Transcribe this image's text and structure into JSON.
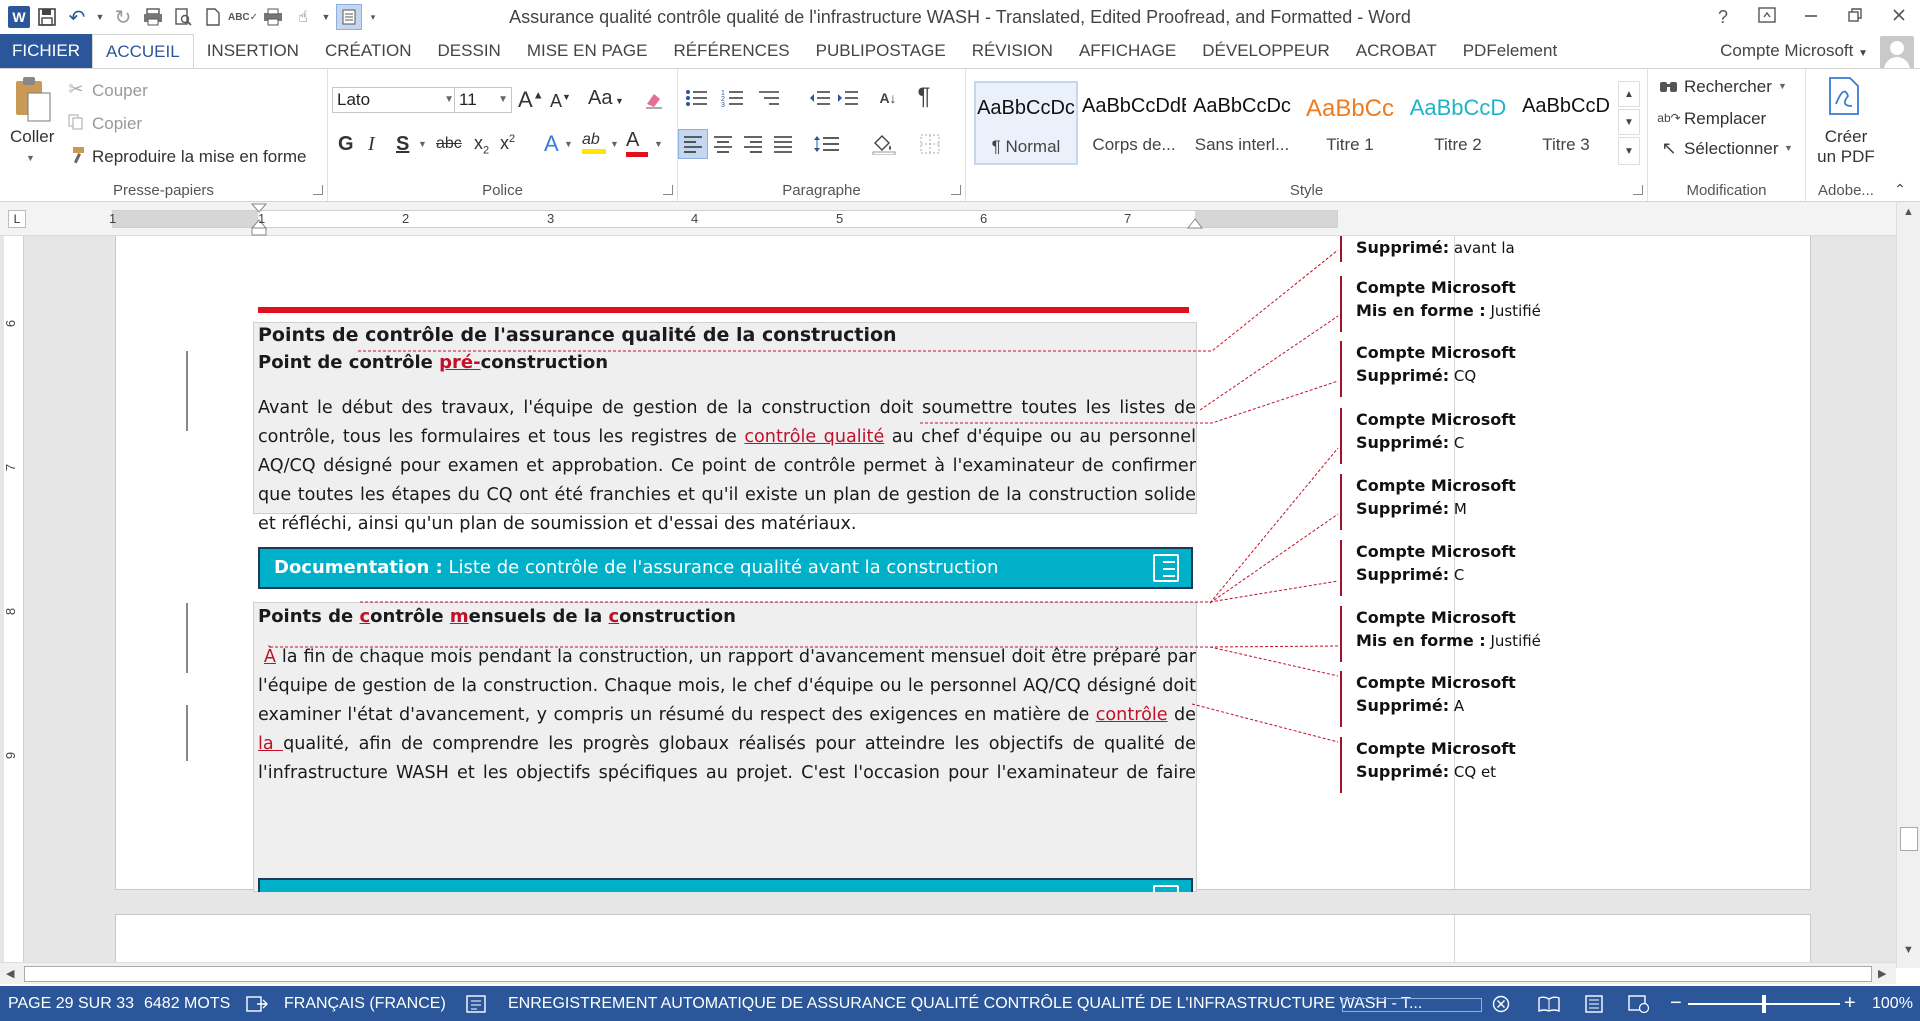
{
  "window": {
    "title": "Assurance qualité  contrôle qualité de l'infrastructure WASH - Translated, Edited Proofread, and Formatted - Word",
    "help": "?",
    "app_logo": "W"
  },
  "tabs": [
    {
      "label": "FICHIER"
    },
    {
      "label": "ACCUEIL"
    },
    {
      "label": "INSERTION"
    },
    {
      "label": "CRÉATION"
    },
    {
      "label": "DESSIN"
    },
    {
      "label": "MISE EN PAGE"
    },
    {
      "label": "RÉFÉRENCES"
    },
    {
      "label": "PUBLIPOSTAGE"
    },
    {
      "label": "RÉVISION"
    },
    {
      "label": "AFFICHAGE"
    },
    {
      "label": "DÉVELOPPEUR"
    },
    {
      "label": "ACROBAT"
    },
    {
      "label": "PDFelement"
    }
  ],
  "account": "Compte Microsoft",
  "clipboard": {
    "paste": "Coller",
    "cut": "Couper",
    "copy": "Copier",
    "format_painter": "Reproduire la mise en forme",
    "label": "Presse-papiers"
  },
  "font": {
    "name": "Lato",
    "size": "11",
    "label": "Police",
    "case_btn": "Aa",
    "bold": "G",
    "italic": "I",
    "underline": "S",
    "strike": "abc",
    "subscript": "x",
    "subscript_mark": "2",
    "superscript": "x",
    "superscript_mark": "2",
    "grow": "A",
    "shrink": "A",
    "effects": "A",
    "highlight": "ab",
    "color": "A",
    "highlight_color": "#ffe600",
    "font_color": "#e0101e"
  },
  "paragraph": {
    "label": "Paragraphe"
  },
  "styles": {
    "label": "Style",
    "items": [
      {
        "sample": "AaBbCcDc",
        "name": "¶ Normal",
        "color": "#111111"
      },
      {
        "sample": "AaBbCcDdE",
        "name": "Corps de...",
        "color": "#111111"
      },
      {
        "sample": "AaBbCcDc",
        "name": "Sans interl...",
        "color": "#111111"
      },
      {
        "sample": "AaBbCc",
        "name": "Titre 1",
        "color": "#f07b1c"
      },
      {
        "sample": "AaBbCcD",
        "name": "Titre 2",
        "color": "#1fb3c8"
      },
      {
        "sample": "AaBbCcD",
        "name": "Titre 3",
        "color": "#111111"
      }
    ]
  },
  "editing": {
    "find": "Rechercher",
    "replace": "Remplacer",
    "select": "Sélectionner",
    "label": "Modification"
  },
  "adobe": {
    "create_line1": "Créer",
    "create_line2": "un PDF",
    "label": "Adobe..."
  },
  "ruler": {
    "corner": "L",
    "numbers": [
      "1",
      "1",
      "2",
      "3",
      "4",
      "5",
      "6",
      "7"
    ],
    "vertical": [
      "6",
      "7",
      "8",
      "9"
    ]
  },
  "document": {
    "heading": "Points de contrôle de l'assurance qualité de la construction",
    "sub1_a": "Point de contrôle ",
    "sub1_ins": "pré-",
    "sub1_b": "construction",
    "para1": {
      "l1": "Avant le début des travaux, l'équipe de gestion de la construction doit soumettre toutes les listes de",
      "l2_a": "contrôle, tous les formulaires et tous les registres de ",
      "l2_ins": "contrôle qualité",
      "l2_b": " au chef d'équipe ou au personnel",
      "l3": "AQ/CQ désigné pour examen et approbation. Ce point de contrôle permet à l'examinateur de confirmer",
      "l4": "que toutes les étapes du CQ ont été franchies et qu'il existe un plan de gestion de la construction solide",
      "l5": "et réfléchi, ainsi qu'un plan de soumission et d'essai des matériaux."
    },
    "doc_box": {
      "bold": "Documentation :",
      "text": " Liste de contrôle de l'assurance qualité avant la construction"
    },
    "sub2": {
      "a": "Points de ",
      "i1": "c",
      "b": "ontrôle ",
      "i2": "m",
      "c": "ensuels de la ",
      "i3": "c",
      "d": "onstruction"
    },
    "para2": {
      "l1_ins": "À",
      "l1": " la fin de chaque mois pendant la construction, un rapport d'avancement mensuel doit être préparé par",
      "l2": "l'équipe de gestion de la construction. Chaque mois, le chef d'équipe ou le personnel AQ/CQ désigné doit",
      "l3_a": "examiner l'état d'avancement, y compris un résumé du respect des exigences en matière de ",
      "l3_ins": "contrôle",
      "l3_b": " de",
      "l4_ins": "la ",
      "l4": "qualité, afin de comprendre les progrès globaux réalisés pour atteindre les objectifs de qualité de",
      "l5": "l'infrastructure WASH et les objectifs spécifiques au projet. C'est l'occasion pour l'examinateur de faire"
    }
  },
  "comments": [
    {
      "author": "",
      "kind": "Supprimé:",
      "detail": "avant la"
    },
    {
      "author": "Compte Microsoft",
      "kind": "Mis en forme :",
      "detail": "Justifié"
    },
    {
      "author": "Compte Microsoft",
      "kind": "Supprimé:",
      "detail": "CQ"
    },
    {
      "author": "Compte Microsoft",
      "kind": "Supprimé:",
      "detail": "C"
    },
    {
      "author": "Compte Microsoft",
      "kind": "Supprimé:",
      "detail": "M"
    },
    {
      "author": "Compte Microsoft",
      "kind": "Supprimé:",
      "detail": "C"
    },
    {
      "author": "Compte Microsoft",
      "kind": "Mis en forme :",
      "detail": "Justifié"
    },
    {
      "author": "Compte Microsoft",
      "kind": "Supprimé:",
      "detail": "A"
    },
    {
      "author": "Compte Microsoft",
      "kind": "Supprimé:",
      "detail": "CQ et"
    }
  ],
  "status": {
    "page": "PAGE 29 SUR 33",
    "words": "6482 MOTS",
    "language": "FRANÇAIS (FRANCE)",
    "autosave": "ENREGISTREMENT AUTOMATIQUE DE ASSURANCE QUALITÉ  CONTRÔLE QUALITÉ DE L'INFRASTRUCTURE WASH - T...",
    "zoom_out": "−",
    "zoom_in": "+",
    "zoom": "100%"
  },
  "colors": {
    "brand": "#2b579a",
    "track_change": "#c0102a",
    "doc_box": "#00b0c8",
    "red_rule": "#e0101e"
  }
}
